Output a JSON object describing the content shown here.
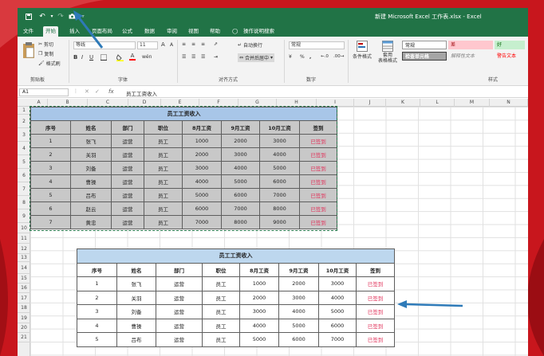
{
  "window": {
    "title": "新建 Microsoft Excel 工作表.xlsx  -  Excel"
  },
  "tabs": [
    "文件",
    "开始",
    "插入",
    "页面布局",
    "公式",
    "数据",
    "审阅",
    "视图",
    "帮助",
    "操作说明搜索"
  ],
  "ribbon": {
    "clipboard": {
      "cut": "剪切",
      "copy": "复制",
      "format_painter": "格式刷",
      "label": "剪贴板"
    },
    "font": {
      "name": "等线",
      "size": "11",
      "bold": "B",
      "italic": "I",
      "underline": "U",
      "grow": "A",
      "shrink": "A",
      "color": "A",
      "phonetic": "wén",
      "label": "字体"
    },
    "alignment": {
      "wrap": "自动换行",
      "merge": "合并后居中",
      "label": "对齐方式"
    },
    "number": {
      "format": "常规",
      "label": "数字"
    },
    "styles": {
      "conditional": "条件格式",
      "table": "套用\n表格格式",
      "normal": "常规",
      "bad": "差",
      "good": "好",
      "check_cell": "检查单元格",
      "explanatory": "解释性文本",
      "warning": "警告文本",
      "label": "样式"
    }
  },
  "formula_bar": {
    "name_box": "A1",
    "fx": "fx",
    "content": "员工工资收入"
  },
  "columns": [
    "A",
    "B",
    "C",
    "D",
    "E",
    "F",
    "G",
    "H",
    "I",
    "J",
    "K",
    "L",
    "M",
    "N"
  ],
  "rows": [
    "1",
    "2",
    "3",
    "4",
    "5",
    "6",
    "7",
    "8",
    "9",
    "10",
    "11",
    "12",
    "13",
    "14",
    "15",
    "16",
    "17",
    "18",
    "19",
    "20",
    "21"
  ],
  "table1": {
    "title": "员工工资收入",
    "headers": [
      "序号",
      "姓名",
      "部门",
      "职位",
      "8月工资",
      "9月工资",
      "10月工资",
      "签到"
    ],
    "rows": [
      [
        "1",
        "张飞",
        "运营",
        "员工",
        "1000",
        "2000",
        "3000",
        "已签到"
      ],
      [
        "2",
        "关羽",
        "运营",
        "员工",
        "2000",
        "3000",
        "4000",
        "已签到"
      ],
      [
        "3",
        "刘备",
        "运营",
        "员工",
        "3000",
        "4000",
        "5000",
        "已签到"
      ],
      [
        "4",
        "曹操",
        "运营",
        "员工",
        "4000",
        "5000",
        "6000",
        "已签到"
      ],
      [
        "5",
        "吕布",
        "运营",
        "员工",
        "5000",
        "6000",
        "7000",
        "已签到"
      ],
      [
        "6",
        "赵云",
        "运营",
        "员工",
        "6000",
        "7000",
        "8000",
        "已签到"
      ],
      [
        "7",
        "黄忠",
        "运营",
        "员工",
        "7000",
        "8000",
        "9000",
        "已签到"
      ]
    ]
  },
  "table2": {
    "title": "员工工资收入",
    "headers": [
      "序号",
      "姓名",
      "部门",
      "职位",
      "8月工资",
      "9月工资",
      "10月工资",
      "签到"
    ],
    "rows": [
      [
        "1",
        "张飞",
        "运营",
        "员工",
        "1000",
        "2000",
        "3000",
        "已签到"
      ],
      [
        "2",
        "关羽",
        "运营",
        "员工",
        "2000",
        "3000",
        "4000",
        "已签到"
      ],
      [
        "3",
        "刘备",
        "运营",
        "员工",
        "3000",
        "4000",
        "5000",
        "已签到"
      ],
      [
        "4",
        "曹操",
        "运营",
        "员工",
        "4000",
        "5000",
        "6000",
        "已签到"
      ],
      [
        "5",
        "吕布",
        "运营",
        "员工",
        "5000",
        "6000",
        "7000",
        "已签到"
      ]
    ]
  },
  "colors": {
    "excel_green": "#217346",
    "signed_text": "#e0325a",
    "title_fill": "#a8c6e8",
    "arrow": "#2e7ab8"
  }
}
